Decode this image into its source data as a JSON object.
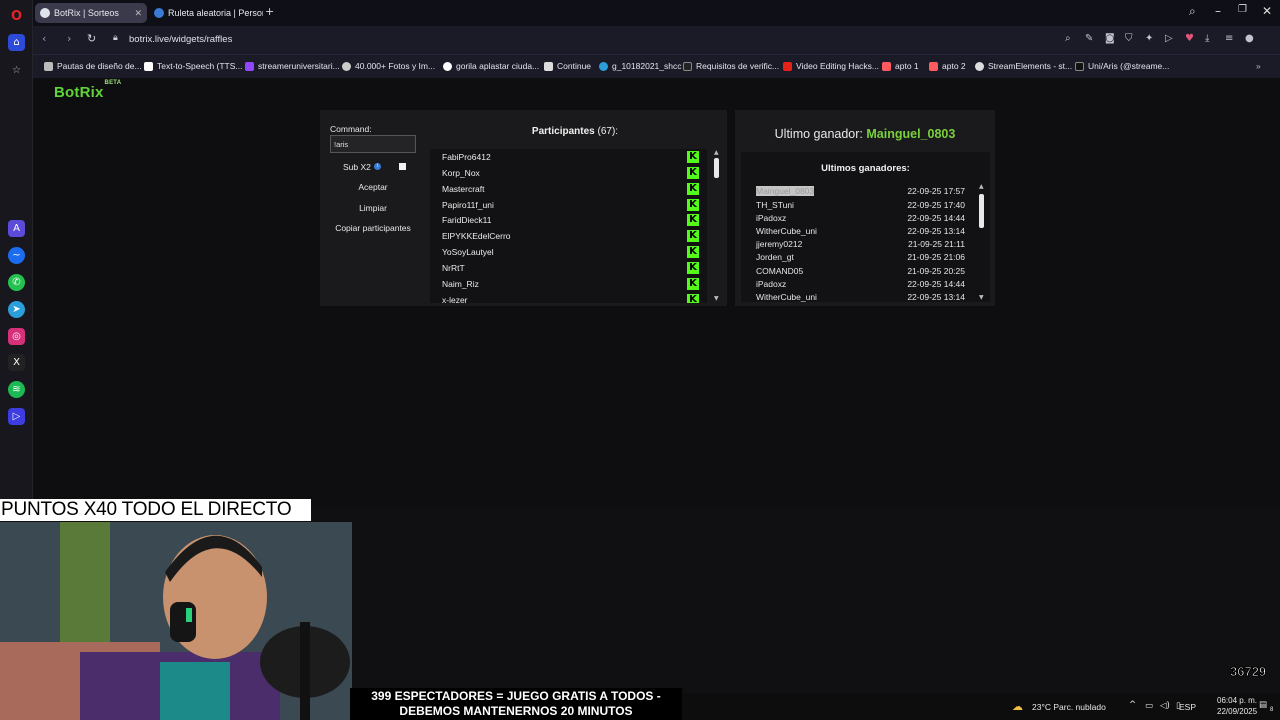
{
  "browser": {
    "tabs": [
      {
        "label": "BotRix | Sorteos",
        "active": true
      },
      {
        "label": "Ruleta aleatoria | Personal",
        "active": false
      }
    ],
    "url": "botrix.live/widgets/raffles",
    "bookmarks": [
      "Pautas de diseño de...",
      "Text-to-Speech (TTS...",
      "streameruniversitari...",
      "40.000+ Fotos y Im...",
      "gorila aplastar ciuda...",
      "Continue",
      "g_10182021_shcc",
      "Requisitos de verific...",
      "Video Editing Hacks...",
      "apto 1",
      "apto 2",
      "StreamElements - st...",
      "Uni/Aris (@streame..."
    ]
  },
  "app": {
    "logo": "BotRix",
    "logo_badge": "BETA"
  },
  "controls": {
    "command_label": "Command:",
    "command_value": "!aris",
    "sub_label": "Sub X2",
    "sub_info_icon": "i",
    "accept_label": "Aceptar",
    "clear_label": "Limpiar",
    "copy_label": "Copiar participantes"
  },
  "participants": {
    "title": "Participantes",
    "count": "(67):",
    "list": [
      "FabiPro6412",
      "Korp_Nox",
      "Mastercraft",
      "Papiro11f_uni",
      "FaridDieck11",
      "ElPYKKEdelCerro",
      "YoSoyLautyel",
      "NrRtT",
      "Naim_Riz",
      "x-lezer"
    ],
    "platform_icon_glyph": "K"
  },
  "winner": {
    "label": "Ultimo ganador:",
    "name": "Mainguel_0803",
    "recent_title": "Ultimos ganadores:",
    "recent": [
      {
        "name": "Mainguel_0803",
        "date": "22-09-25 17:57"
      },
      {
        "name": "TH_STuni",
        "date": "22-09-25 17:40"
      },
      {
        "name": "iPadoxz",
        "date": "22-09-25 14:44"
      },
      {
        "name": "WitherCube_uni",
        "date": "22-09-25 13:14"
      },
      {
        "name": "jjeremy0212",
        "date": "21-09-25 21:11"
      },
      {
        "name": "Jorden_gt",
        "date": "21-09-25 21:06"
      },
      {
        "name": "COMAND05",
        "date": "21-09-25 20:25"
      },
      {
        "name": "iPadoxz",
        "date": "22-09-25 14:44"
      },
      {
        "name": "WitherCube_uni",
        "date": "22-09-25 13:14"
      }
    ]
  },
  "overlay": {
    "points_banner": "PUNTOS X40 TODO EL DIRECTO",
    "viewers_line1": "399 ESPECTADORES = JUEGO GRATIS A TODOS -",
    "viewers_line2": "DEBEMOS MANTENERNOS 20 MINUTOS",
    "pepe_count": "36729"
  },
  "taskbar": {
    "weather": "23°C  Parc. nublado",
    "lang": "ESP",
    "time": "06:04 p. m.",
    "date": "22/09/2025",
    "notif": "8"
  },
  "colors": {
    "accent": "#53fc18",
    "winner_green": "#7ad03d",
    "panel": "#1a1a1c"
  }
}
